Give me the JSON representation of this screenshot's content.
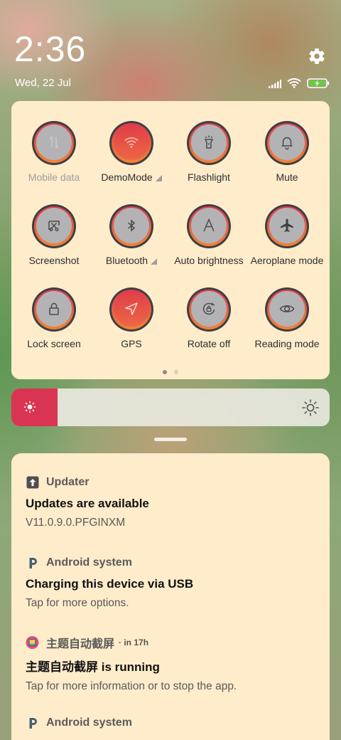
{
  "status": {
    "time": "2:36",
    "date": "Wed, 22 Jul"
  },
  "quick_settings": {
    "tiles": [
      {
        "label": "Mobile data",
        "icon": "mobile-data-icon",
        "active": false,
        "dim": true,
        "has_menu": false
      },
      {
        "label": "DemoMode",
        "icon": "wifi-icon",
        "active": true,
        "dim": false,
        "has_menu": true
      },
      {
        "label": "Flashlight",
        "icon": "flashlight-icon",
        "active": false,
        "dim": false,
        "has_menu": false
      },
      {
        "label": "Mute",
        "icon": "bell-icon",
        "active": false,
        "dim": false,
        "has_menu": false
      },
      {
        "label": "Screenshot",
        "icon": "screenshot-icon",
        "active": false,
        "dim": false,
        "has_menu": false
      },
      {
        "label": "Bluetooth",
        "icon": "bluetooth-icon",
        "active": false,
        "dim": false,
        "has_menu": true
      },
      {
        "label": "Auto brightness",
        "icon": "auto-brightness-icon",
        "active": false,
        "dim": false,
        "has_menu": false
      },
      {
        "label": "Aeroplane mode",
        "icon": "airplane-icon",
        "active": false,
        "dim": false,
        "has_menu": false
      },
      {
        "label": "Lock screen",
        "icon": "lock-icon",
        "active": false,
        "dim": false,
        "has_menu": false
      },
      {
        "label": "GPS",
        "icon": "location-icon",
        "active": true,
        "dim": false,
        "has_menu": false
      },
      {
        "label": "Rotate off",
        "icon": "rotate-lock-icon",
        "active": false,
        "dim": false,
        "has_menu": false
      },
      {
        "label": "Reading mode",
        "icon": "eye-icon",
        "active": false,
        "dim": false,
        "has_menu": false
      }
    ],
    "page_count": 2,
    "current_page": 1
  },
  "brightness": {
    "level": 0.145
  },
  "notifications": [
    {
      "app": "Updater",
      "time": "",
      "icon": "updater-icon",
      "title": "Updates are available",
      "text": "V11.0.9.0.PFGINXM"
    },
    {
      "app": "Android system",
      "time": "",
      "icon": "android-system-icon",
      "title": "Charging this device via USB",
      "text": "Tap for more options."
    },
    {
      "app": "主题自动截屏",
      "time": "· in 17h",
      "icon": "app-screenshot-icon",
      "title": "主题自动截屏 is running",
      "text": "Tap for more information or to stop the app."
    },
    {
      "app": "Android system",
      "time": "",
      "icon": "android-system-icon",
      "title": "",
      "text": ""
    }
  ],
  "colors": {
    "panel_bg": "#feeccb",
    "accent_red": "#dd3b50",
    "accent_orange": "#f08438",
    "tile_off": "#b3b3b6"
  }
}
